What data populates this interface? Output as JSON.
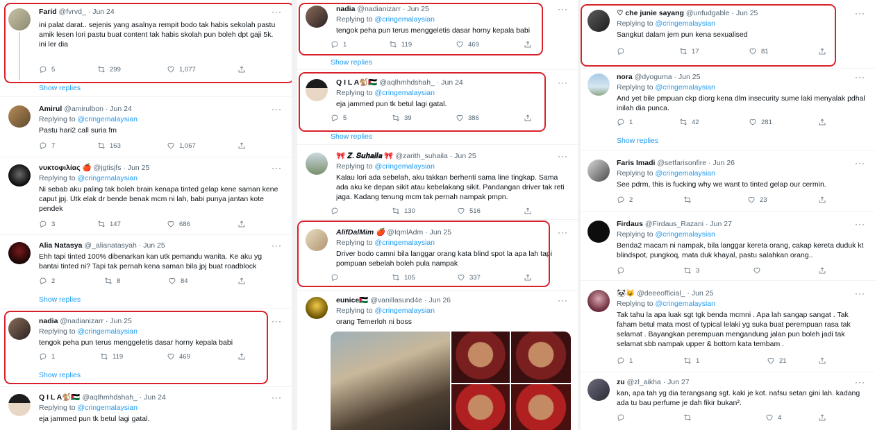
{
  "mention": "@cringemalaysian",
  "replying_prefix": "Replying to",
  "show_replies": "Show replies",
  "more": "···",
  "col1": {
    "t1": {
      "name": "Farid",
      "handle": "@fvrvd_",
      "date": "Jun 24",
      "text": "ini palat darat.. sejenis yang asalnya rempit bodo tak habis sekolah pastu amik lesen lori pastu buat content tak habis skolah pun boleh dpt gaji 5k. ini ler dia",
      "replies": "5",
      "retweets": "299",
      "likes": "1,077"
    },
    "t2": {
      "name": "Amirul",
      "handle": "@amirulbon",
      "date": "Jun 24",
      "text": "Pastu hari2 call suria fm",
      "replies": "7",
      "retweets": "163",
      "likes": "1,067"
    },
    "t3": {
      "name": "νυκτοφιλίας 🍎",
      "handle": "@jgtisjfs",
      "date": "Jun 25",
      "text": "Ni sebab aku paling tak boleh brain kenapa tinted gelap kene saman kene caput jpj. Utk elak dr bende benak mcm ni lah, babi punya jantan kote pendek",
      "replies": "3",
      "retweets": "147",
      "likes": "686"
    },
    "t4": {
      "name": "Alia Natasya",
      "handle": "@_alianatasyah",
      "date": "Jun 25",
      "text": "Ehh tapi tinted 100% dibenarkan kan utk pemandu wanita. Ke aku yg bantai tinted ni? Tapi tak pernah kena saman bila jpj buat roadblock",
      "replies": "2",
      "retweets": "8",
      "likes": "84"
    },
    "t5": {
      "name": "nadia",
      "handle": "@nadianizarr",
      "date": "Jun 25",
      "text": "tengok peha pun terus menggeletis dasar horny kepala babi",
      "replies": "1",
      "retweets": "119",
      "likes": "469"
    },
    "t6": {
      "name": "Q I L A🐒🇵🇸",
      "handle": "@aqlhmhdshah_",
      "date": "Jun 24",
      "text": "eja jammed pun tk betul lagi gatal."
    }
  },
  "col2": {
    "t1": {
      "name": "nadia",
      "handle": "@nadianizarr",
      "date": "Jun 25",
      "text": "tengok peha pun terus menggeletis dasar horny kepala babi",
      "replies": "1",
      "retweets": "119",
      "likes": "469"
    },
    "t2": {
      "name": "Q I L A🐒🇵🇸",
      "handle": "@aqlhmhdshah_",
      "date": "Jun 24",
      "text": "eja jammed pun tk betul lagi gatal.",
      "replies": "5",
      "retweets": "39",
      "likes": "386"
    },
    "t3": {
      "name": "🎀 𝒁. 𝑺𝒖𝒉𝒂𝒊𝒍𝒂 🎀",
      "handle": "@zarith_suhaila",
      "date": "Jun 25",
      "text": "Kalau lori ada sebelah, aku takkan berhenti sama line tingkap. Sama ada aku ke depan sikit atau kebelakang sikit. Pandangan driver tak reti jaga. Kadang tenung mcm tak pernah nampak pmpn.",
      "replies": "",
      "retweets": "130",
      "likes": "516"
    },
    "t4": {
      "name": "AlifDalMim 🍎",
      "handle": "@IqmlAdm",
      "date": "Jun 25",
      "text": "Driver bodo camni bila langgar orang kata blind spot la apa lah tapi pompuan sebelah boleh pula nampak",
      "replies": "",
      "retweets": "105",
      "likes": "337"
    },
    "t5": {
      "name": "eunice🇵🇸",
      "handle": "@vanillasund4e",
      "date": "Jun 26",
      "text": "orang Temerloh ni boss"
    }
  },
  "col3": {
    "t1": {
      "name": "♡ che junie sayang",
      "handle": "@unfudgable",
      "date": "Jun 25",
      "text": "Sangkut dalam jem pun kena sexualised",
      "replies": "",
      "retweets": "17",
      "likes": "81"
    },
    "t2": {
      "name": "nora",
      "handle": "@dyoguma",
      "date": "Jun 25",
      "text": "And yet bile pmpuan ckp diorg kena dlm insecurity sume laki menyalak pdhal inilah dia punca.",
      "replies": "1",
      "retweets": "42",
      "likes": "281"
    },
    "t3": {
      "name": "Faris Imadi",
      "handle": "@setfarisonfire",
      "date": "Jun 26",
      "text": "See pdrm, this is fucking why we want to tinted gelap our cermin.",
      "replies": "2",
      "retweets": "",
      "likes": "23"
    },
    "t4": {
      "name": "Firdaus",
      "handle": "@Firdaus_Razani",
      "date": "Jun 27",
      "text": "Benda2 macam ni nampak, bila langgar kereta orang, cakap kereta duduk kt blindspot, pungkoq, mata duk khayal, pastu salahkan orang..",
      "replies": "",
      "retweets": "3",
      "likes": ""
    },
    "t5": {
      "name": "🐼😺",
      "handle": "@deeeofficial_",
      "date": "Jun 25",
      "text": "Tak tahu la apa luak sgt tgk benda mcmni . Apa lah sangap sangat . Tak faham betul mata most of typical lelaki yg suka buat perempuan rasa tak selamat . Bayangkan perempuan mengandung jalan pun boleh jadi tak selamat sbb nampak upper & bottom kata tembam .",
      "replies": "1",
      "retweets": "1",
      "likes": "21"
    },
    "t6": {
      "name": "zu",
      "handle": "@zl_aikha",
      "date": "Jun 27",
      "text": "kan, apa tah yg dia terangsang sgt. kaki je kot. nafsu setan gini lah. kadang ada tu bau perfume je dah fikir bukan².",
      "replies": "",
      "retweets": "",
      "likes": "4"
    }
  },
  "colors": {
    "highlight": "#d9202a",
    "link": "#1d9bf0",
    "muted": "#536471"
  }
}
